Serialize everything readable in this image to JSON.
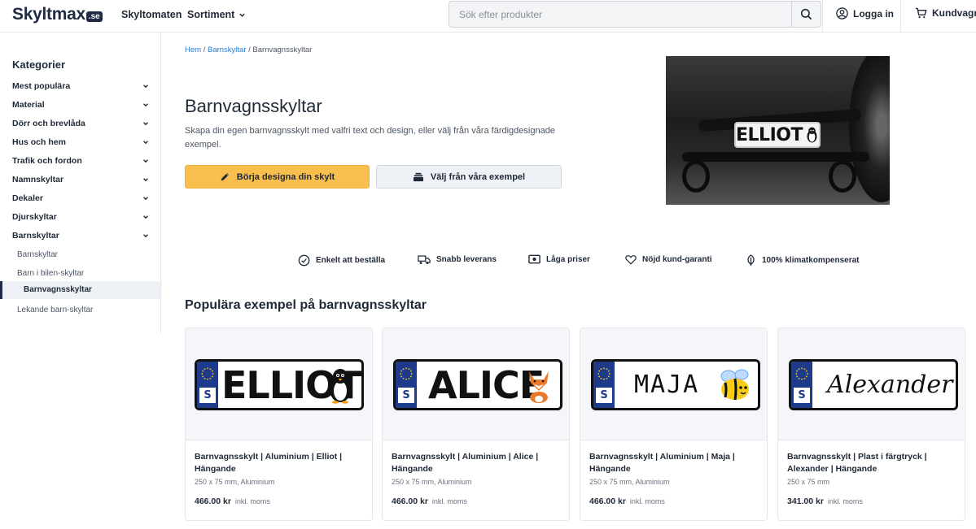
{
  "header": {
    "logo_text": "Skyltmax",
    "logo_badge": ".se",
    "nav": [
      "Skyltomaten",
      "Sortiment"
    ],
    "search_placeholder": "Sök efter produkter",
    "login_label": "Logga in",
    "cart_label": "Kundvagn"
  },
  "sidebar": {
    "title": "Kategorier",
    "categories": [
      "Mest populära",
      "Material",
      "Dörr och brevlåda",
      "Hus och hem",
      "Trafik och fordon",
      "Namnskyltar",
      "Dekaler",
      "Djurskyltar",
      "Barnskyltar"
    ],
    "subcategories": [
      "Barnskyltar",
      "Barn i bilen-skyltar",
      "Barnvagnsskyltar",
      "Lekande barn-skyltar"
    ],
    "active_sub": "Barnvagnsskyltar"
  },
  "breadcrumb": {
    "home": "Hem",
    "parent": "Barnskyltar",
    "current": "Barnvagnsskyltar",
    "sep": "/"
  },
  "hero": {
    "title": "Barnvagnsskyltar",
    "lead": "Skapa din egen barnvagnsskylt med valfri text och design, eller välj från våra färdigdesignade exempel.",
    "primary_button": "Börja designa din skylt",
    "secondary_button": "Välj från våra exempel",
    "plate_text": "ELLIOT"
  },
  "features": [
    "Enkelt att beställa",
    "Snabb leverans",
    "Låga priser",
    "Nöjd kund-garanti",
    "100% klimatkompenserat"
  ],
  "section_title": "Populära exempel på barnvagnsskyltar",
  "products": [
    {
      "plate_text": "ELLIOT",
      "plate_letter": "S",
      "art": "penguin",
      "title": "Barnvagnsskylt | Aluminium | Elliot | Hängande",
      "sub": "250 x 75 mm, Aluminium",
      "price": "466.00 kr",
      "vat": "inkl. moms"
    },
    {
      "plate_text": "ALICE",
      "plate_letter": "S",
      "art": "fox",
      "title": "Barnvagnsskylt | Aluminium | Alice | Hängande",
      "sub": "250 x 75 mm, Aluminium",
      "price": "466.00 kr",
      "vat": "inkl. moms"
    },
    {
      "plate_text": "MAJA",
      "plate_letter": "S",
      "art": "bee",
      "title": "Barnvagnsskylt | Aluminium | Maja | Hängande",
      "sub": "250 x 75 mm, Aluminium",
      "price": "466.00 kr",
      "vat": "inkl. moms"
    },
    {
      "plate_text": "Alexander",
      "plate_letter": "S",
      "art": "none",
      "title": "Barnvagnsskylt | Plast i färgtryck | Alexander | Hängande",
      "sub": "250 x 75 mm",
      "price": "341.00 kr",
      "vat": "inkl. moms"
    }
  ],
  "colors": {
    "brand": "#1f2a44",
    "accent": "#f8bf4f",
    "link": "#2b7bd0",
    "eu_blue": "#1e3a8a"
  }
}
